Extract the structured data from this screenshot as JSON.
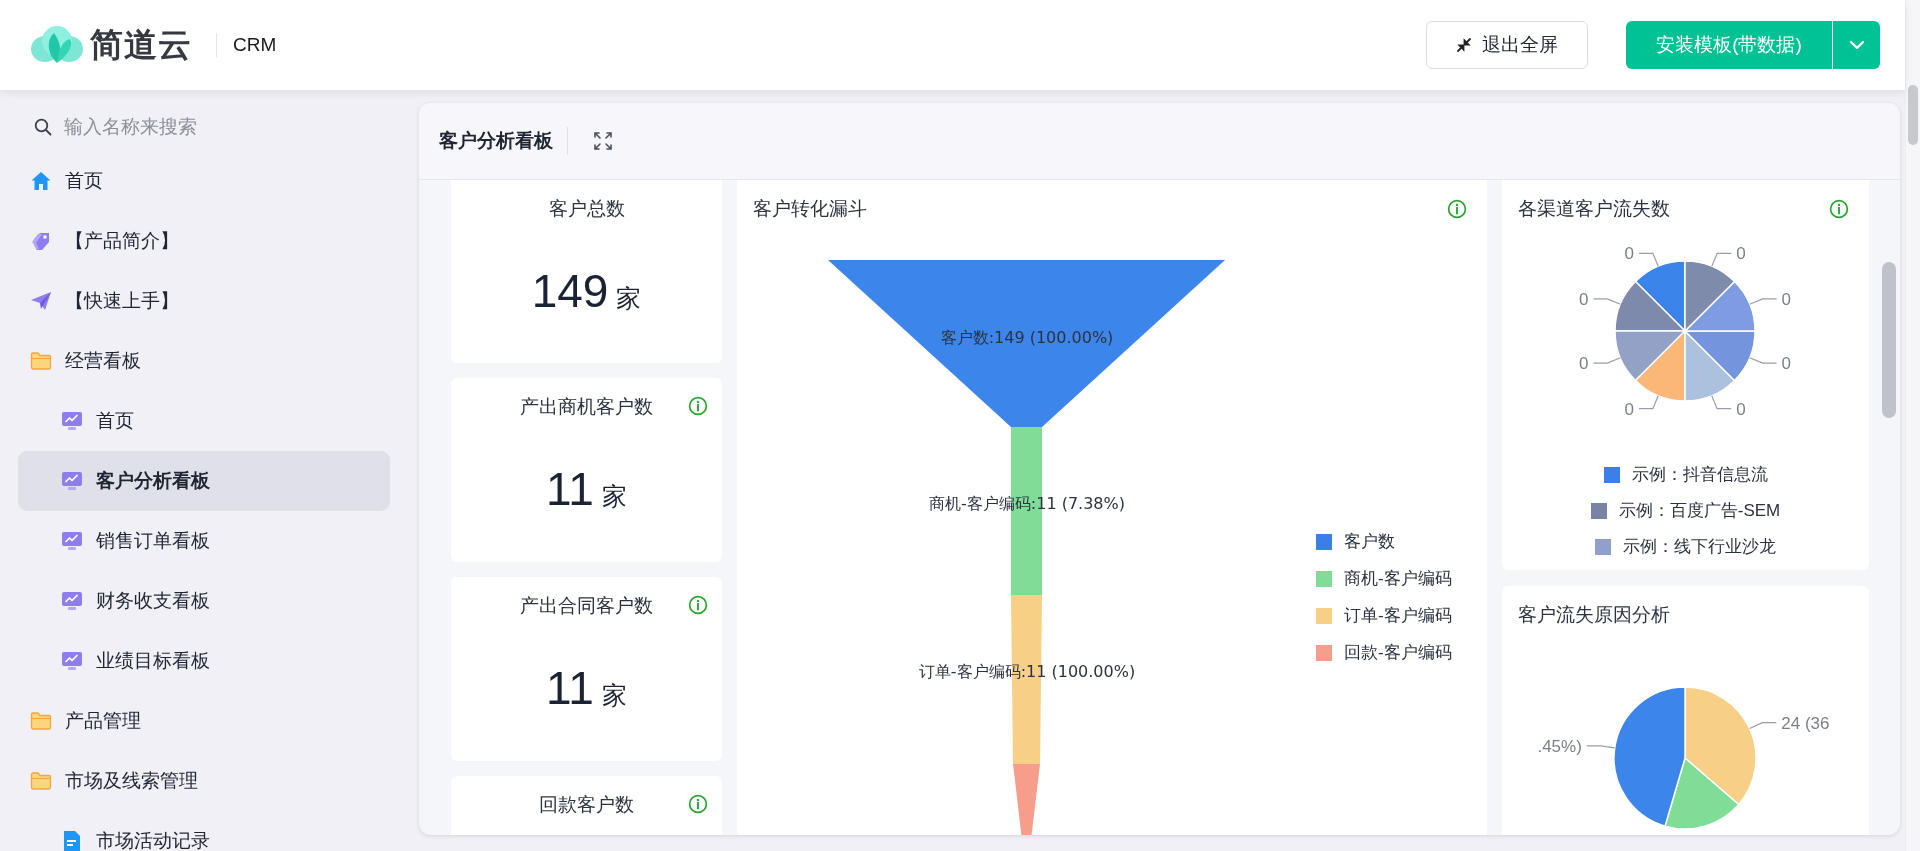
{
  "app": {
    "brand": "简道云",
    "product": "CRM"
  },
  "exit_fullscreen_button": {
    "label": "退出全屏"
  },
  "install_button": {
    "label": "安装模板(带数据)"
  },
  "sidebar": {
    "search": {
      "placeholder": "输入名称来搜索"
    },
    "items": [
      {
        "label": "首页",
        "kind": "home",
        "selected": false
      },
      {
        "label": "【产品简介】",
        "kind": "tag",
        "selected": false
      },
      {
        "label": "【快速上手】",
        "kind": "plane",
        "selected": false
      },
      {
        "label": "经营看板",
        "kind": "folder",
        "selected": false,
        "children": [
          {
            "label": "首页",
            "kind": "dashboard",
            "selected": false
          },
          {
            "label": "客户分析看板",
            "kind": "dashboard",
            "selected": true
          },
          {
            "label": "销售订单看板",
            "kind": "dashboard",
            "selected": false
          },
          {
            "label": "财务收支看板",
            "kind": "dashboard",
            "selected": false
          },
          {
            "label": "业绩目标看板",
            "kind": "dashboard",
            "selected": false
          }
        ]
      },
      {
        "label": "产品管理",
        "kind": "folder",
        "selected": false
      },
      {
        "label": "市场及线索管理",
        "kind": "folder",
        "selected": false,
        "children": [
          {
            "label": "市场活动记录",
            "kind": "form",
            "selected": false
          }
        ]
      }
    ]
  },
  "dashboard": {
    "title": "客户分析看板",
    "metrics": [
      {
        "title": "客户总数",
        "value": "149",
        "unit": "家",
        "info": false
      },
      {
        "title": "产出商机客户数",
        "value": "11",
        "unit": "家",
        "info": true
      },
      {
        "title": "产出合同客户数",
        "value": "11",
        "unit": "家",
        "info": true
      },
      {
        "title": "回款客户数",
        "info": true
      }
    ],
    "funnel": {
      "title": "客户转化漏斗",
      "info": true,
      "stages": [
        {
          "label": "客户数:149 (100.00%)",
          "color": "#3c85ea"
        },
        {
          "label": "商机-客户编码:11 (7.38%)",
          "color": "#80dd98"
        },
        {
          "label": "订单-客户编码:11 (100.00%)",
          "color": "#f8cf86"
        },
        {
          "color": "#f79d8c"
        }
      ],
      "legend": [
        {
          "label": "客户数",
          "color": "#3a7fe8"
        },
        {
          "label": "商机-客户编码",
          "color": "#80dd98"
        },
        {
          "label": "订单-客户编码",
          "color": "#f8cf86"
        },
        {
          "label": "回款-客户编码",
          "color": "#f79d8c"
        }
      ]
    },
    "channel_loss": {
      "title": "各渠道客户流失数",
      "info": true,
      "slices": [
        {
          "color": "#3b85ea",
          "label": "0"
        },
        {
          "color": "#7e8aab",
          "label": "0"
        },
        {
          "color": "#94a1c6",
          "label": "0"
        },
        {
          "color": "#fbb777",
          "label": "0"
        },
        {
          "color": "#abc1de",
          "label": "0"
        },
        {
          "color": "#7594de",
          "label": "0"
        },
        {
          "color": "#7f9ce3",
          "label": "0"
        },
        {
          "color": "#7f8bab",
          "label": "0"
        }
      ],
      "legend": [
        {
          "label": "示例：抖音信息流",
          "color": "#3b7fe8"
        },
        {
          "label": "示例：百度广告-SEM",
          "color": "#7784a6"
        },
        {
          "label": "示例：线下行业沙龙",
          "color": "#909fcc"
        }
      ]
    },
    "loss_reasons": {
      "title": "客户流失原因分析",
      "chart_data": {
        "type": "pie",
        "values": [
          36.36,
          18.18,
          45.46
        ],
        "colors": [
          "#f8cf86",
          "#80dd98",
          "#3c85ea"
        ]
      },
      "callouts": [
        {
          "text": "24 (36",
          "kind": "right"
        },
        {
          "text": ".45%)",
          "kind": "left"
        }
      ]
    }
  }
}
